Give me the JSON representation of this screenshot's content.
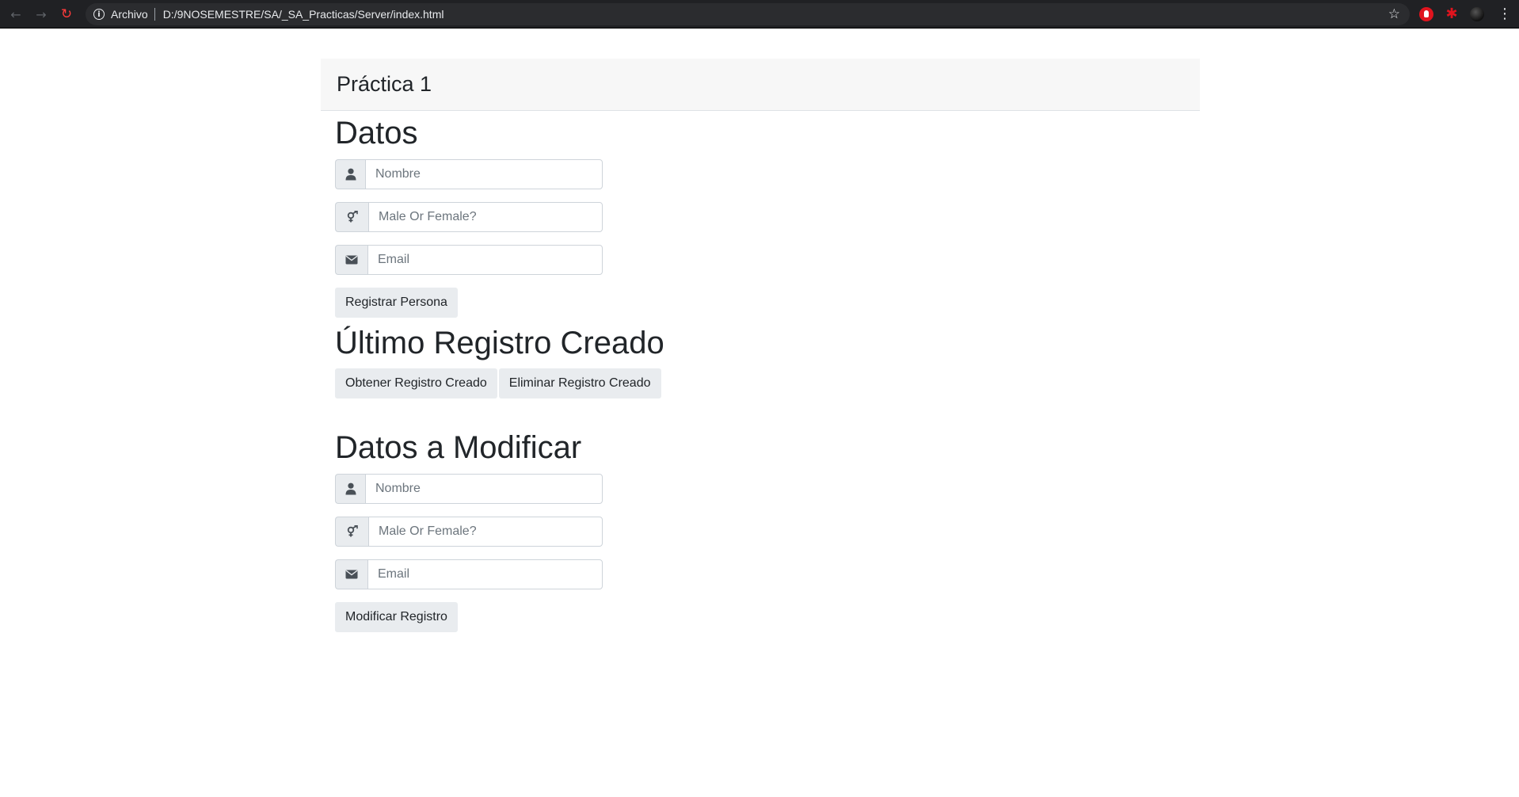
{
  "browser": {
    "scheme_label": "Archivo",
    "url": "D:/9NOSEMESTRE/SA/_SA_Practicas/Server/index.html",
    "icons": [
      "back-arrow-icon",
      "forward-arrow-icon",
      "reload-icon",
      "info-icon",
      "star-icon",
      "extension-icon",
      "puzzle-icon",
      "profile-avatar-icon",
      "menu-dots-icon"
    ]
  },
  "navbar": {
    "brand": "Práctica 1"
  },
  "datos": {
    "heading": "Datos",
    "nombre_placeholder": "Nombre",
    "genero_placeholder": "Male Or Female?",
    "email_placeholder": "Email",
    "submit_label": "Registrar Persona"
  },
  "ultimo": {
    "heading": "Último Registro Creado",
    "get_label": "Obtener Registro Creado",
    "delete_label": "Eliminar Registro Creado"
  },
  "modificar": {
    "heading": "Datos a Modificar",
    "nombre_placeholder": "Nombre",
    "genero_placeholder": "Male Or Female?",
    "email_placeholder": "Email",
    "submit_label": "Modificar Registro"
  },
  "colors": {
    "chrome_bg": "#202124",
    "navbar_bg": "#f7f7f7",
    "addon_bg": "#e9ecef",
    "button_bg": "#e9ecef",
    "text": "#212529",
    "accent_red": "#e0141e"
  }
}
